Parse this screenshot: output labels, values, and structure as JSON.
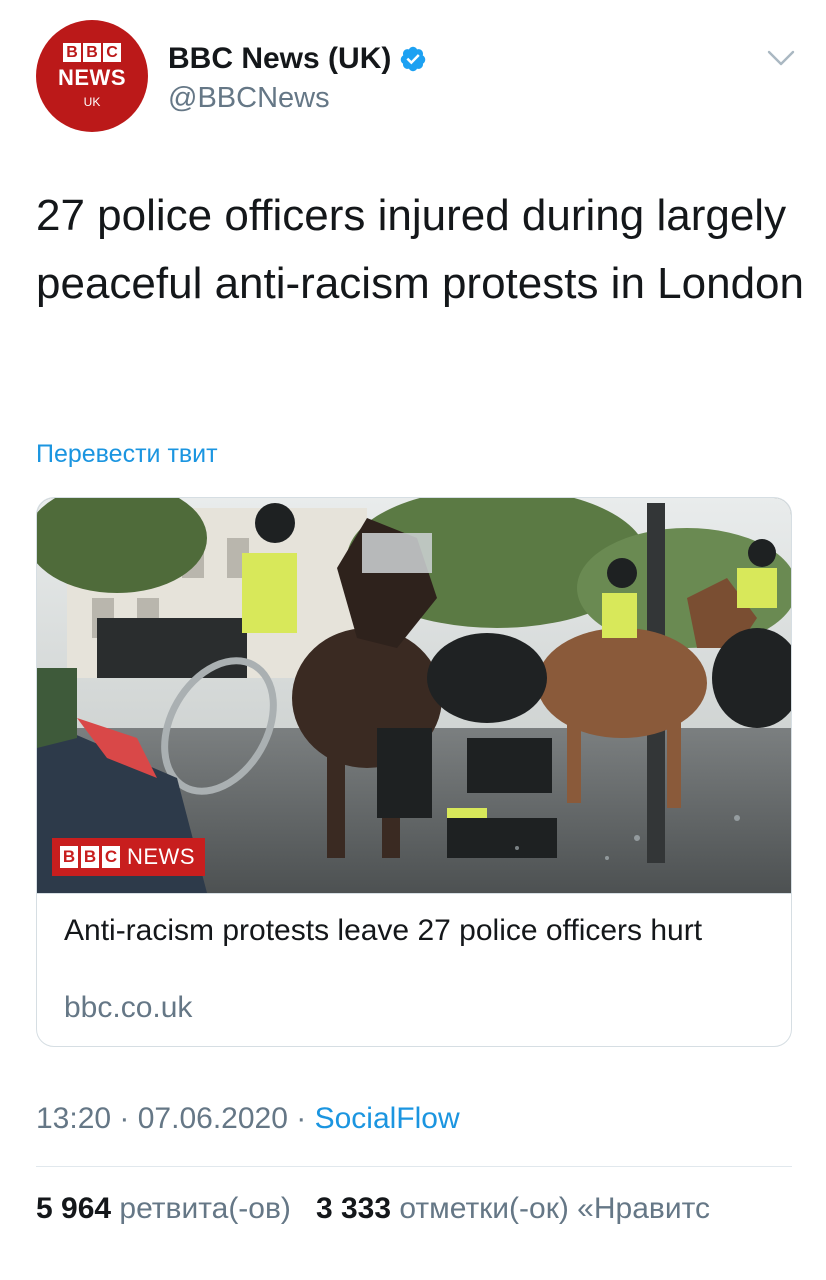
{
  "author": {
    "display_name": "BBC News (UK)",
    "handle": "@BBCNews",
    "avatar": {
      "blocks": [
        "B",
        "B",
        "C"
      ],
      "news": "NEWS",
      "region": "UK",
      "color": "#bb1919"
    },
    "verified_icon": "verified-badge-icon"
  },
  "tweet": {
    "text": "27 police officers injured during largely peaceful anti-racism protests in London",
    "translate_label": "Перевести твит"
  },
  "card": {
    "image_badge": {
      "blocks": [
        "B",
        "B",
        "C"
      ],
      "news": "NEWS"
    },
    "title": "Anti-racism protests leave 27 police officers hurt",
    "domain": "bbc.co.uk"
  },
  "meta": {
    "time": "13:20",
    "sep1": " · ",
    "date": "07.06.2020",
    "sep2": " · ",
    "source": "SocialFlow"
  },
  "stats": {
    "retweets_count": "5 964",
    "retweets_label": "ретвита(-ов)",
    "likes_count": "3 333",
    "likes_label": "отметки(-ок) «Нравитс"
  },
  "colors": {
    "link": "#1b95e0",
    "secondary": "#657786",
    "brand": "#bb1919"
  }
}
